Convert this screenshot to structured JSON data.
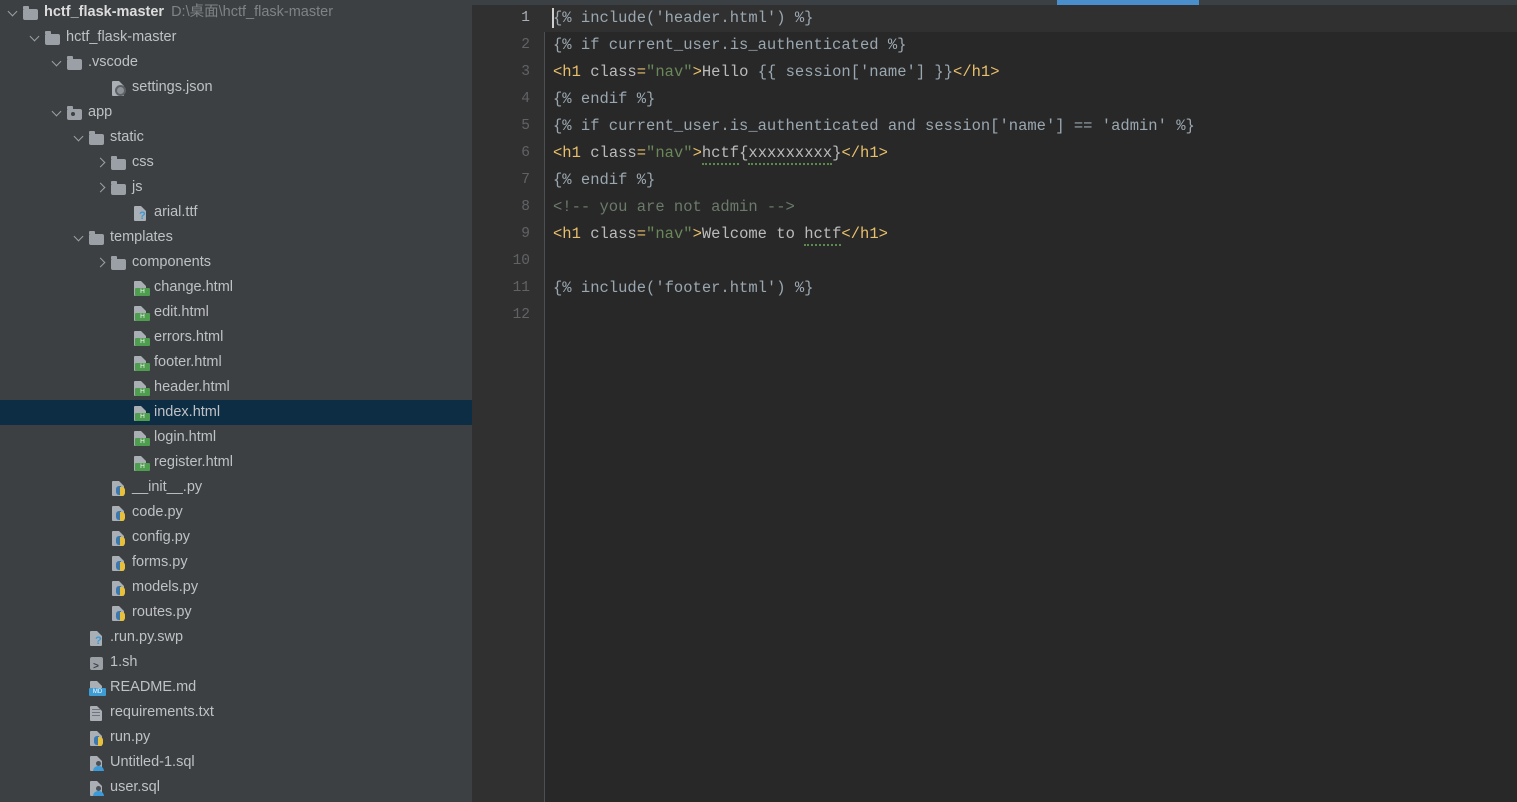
{
  "window": {
    "title": "hctf_flask-master",
    "theme_background": "#282828",
    "sidebar_background": "#3c4043",
    "selection_color": "#0d2d44",
    "accent_color": "#4a8fcc"
  },
  "sidebar": {
    "name": "project-tree",
    "rows": [
      {
        "label": "hctf_flask-master",
        "path_hint": "D:\\桌面\\hctf_flask-master",
        "depth": 0,
        "arrow": "down",
        "icon": "folder-icon",
        "bold": true,
        "selected": false
      },
      {
        "label": "hctf_flask-master",
        "path_hint": "",
        "depth": 1,
        "arrow": "down",
        "icon": "folder-icon",
        "bold": false,
        "selected": false
      },
      {
        "label": ".vscode",
        "path_hint": "",
        "depth": 2,
        "arrow": "down",
        "icon": "folder-icon",
        "bold": false,
        "selected": false
      },
      {
        "label": "settings.json",
        "path_hint": "",
        "depth": 4,
        "arrow": "none",
        "icon": "json-settings-file-icon",
        "bold": false,
        "selected": false
      },
      {
        "label": "app",
        "path_hint": "",
        "depth": 2,
        "arrow": "down",
        "icon": "source-folder-icon",
        "bold": false,
        "selected": false
      },
      {
        "label": "static",
        "path_hint": "",
        "depth": 3,
        "arrow": "down",
        "icon": "folder-icon",
        "bold": false,
        "selected": false
      },
      {
        "label": "css",
        "path_hint": "",
        "depth": 4,
        "arrow": "right",
        "icon": "folder-icon",
        "bold": false,
        "selected": false
      },
      {
        "label": "js",
        "path_hint": "",
        "depth": 4,
        "arrow": "right",
        "icon": "folder-icon",
        "bold": false,
        "selected": false
      },
      {
        "label": "arial.ttf",
        "path_hint": "",
        "depth": 5,
        "arrow": "none",
        "icon": "unknown-file-icon",
        "bold": false,
        "selected": false
      },
      {
        "label": "templates",
        "path_hint": "",
        "depth": 3,
        "arrow": "down",
        "icon": "folder-icon",
        "bold": false,
        "selected": false
      },
      {
        "label": "components",
        "path_hint": "",
        "depth": 4,
        "arrow": "right",
        "icon": "folder-icon",
        "bold": false,
        "selected": false
      },
      {
        "label": "change.html",
        "path_hint": "",
        "depth": 5,
        "arrow": "none",
        "icon": "html-file-icon",
        "bold": false,
        "selected": false
      },
      {
        "label": "edit.html",
        "path_hint": "",
        "depth": 5,
        "arrow": "none",
        "icon": "html-file-icon",
        "bold": false,
        "selected": false
      },
      {
        "label": "errors.html",
        "path_hint": "",
        "depth": 5,
        "arrow": "none",
        "icon": "html-file-icon",
        "bold": false,
        "selected": false
      },
      {
        "label": "footer.html",
        "path_hint": "",
        "depth": 5,
        "arrow": "none",
        "icon": "html-file-icon",
        "bold": false,
        "selected": false
      },
      {
        "label": "header.html",
        "path_hint": "",
        "depth": 5,
        "arrow": "none",
        "icon": "html-file-icon",
        "bold": false,
        "selected": false
      },
      {
        "label": "index.html",
        "path_hint": "",
        "depth": 5,
        "arrow": "none",
        "icon": "html-file-icon",
        "bold": false,
        "selected": true
      },
      {
        "label": "login.html",
        "path_hint": "",
        "depth": 5,
        "arrow": "none",
        "icon": "html-file-icon",
        "bold": false,
        "selected": false
      },
      {
        "label": "register.html",
        "path_hint": "",
        "depth": 5,
        "arrow": "none",
        "icon": "html-file-icon",
        "bold": false,
        "selected": false
      },
      {
        "label": "__init__.py",
        "path_hint": "",
        "depth": 4,
        "arrow": "none",
        "icon": "python-file-icon",
        "bold": false,
        "selected": false
      },
      {
        "label": "code.py",
        "path_hint": "",
        "depth": 4,
        "arrow": "none",
        "icon": "python-file-icon",
        "bold": false,
        "selected": false
      },
      {
        "label": "config.py",
        "path_hint": "",
        "depth": 4,
        "arrow": "none",
        "icon": "python-file-icon",
        "bold": false,
        "selected": false
      },
      {
        "label": "forms.py",
        "path_hint": "",
        "depth": 4,
        "arrow": "none",
        "icon": "python-file-icon",
        "bold": false,
        "selected": false
      },
      {
        "label": "models.py",
        "path_hint": "",
        "depth": 4,
        "arrow": "none",
        "icon": "python-file-icon",
        "bold": false,
        "selected": false
      },
      {
        "label": "routes.py",
        "path_hint": "",
        "depth": 4,
        "arrow": "none",
        "icon": "python-file-icon",
        "bold": false,
        "selected": false
      },
      {
        "label": ".run.py.swp",
        "path_hint": "",
        "depth": 3,
        "arrow": "none",
        "icon": "unknown-file-icon",
        "bold": false,
        "selected": false
      },
      {
        "label": "1.sh",
        "path_hint": "",
        "depth": 3,
        "arrow": "none",
        "icon": "shell-script-icon",
        "bold": false,
        "selected": false
      },
      {
        "label": "README.md",
        "path_hint": "",
        "depth": 3,
        "arrow": "none",
        "icon": "markdown-file-icon",
        "bold": false,
        "selected": false
      },
      {
        "label": "requirements.txt",
        "path_hint": "",
        "depth": 3,
        "arrow": "none",
        "icon": "text-file-icon",
        "bold": false,
        "selected": false
      },
      {
        "label": "run.py",
        "path_hint": "",
        "depth": 3,
        "arrow": "none",
        "icon": "python-file-icon",
        "bold": false,
        "selected": false
      },
      {
        "label": "Untitled-1.sql",
        "path_hint": "",
        "depth": 3,
        "arrow": "none",
        "icon": "sql-file-icon",
        "bold": false,
        "selected": false
      },
      {
        "label": "user.sql",
        "path_hint": "",
        "depth": 3,
        "arrow": "none",
        "icon": "sql-file-icon",
        "bold": false,
        "selected": false
      }
    ]
  },
  "editor": {
    "name": "code-editor",
    "active_line": 1,
    "line_numbers": [
      "1",
      "2",
      "3",
      "4",
      "5",
      "6",
      "7",
      "8",
      "9",
      "10",
      "11",
      "12"
    ],
    "lines": [
      {
        "n": 1,
        "tokens": [
          {
            "t": "{% include('header.html') %}",
            "c": "tk-tpl"
          }
        ]
      },
      {
        "n": 2,
        "tokens": [
          {
            "t": "{% if current_user.is_authenticated %}",
            "c": "tk-tpl"
          }
        ]
      },
      {
        "n": 3,
        "tokens": [
          {
            "t": "<h1 ",
            "c": "tk-tag"
          },
          {
            "t": "class",
            "c": "tk-attr"
          },
          {
            "t": "=",
            "c": "tk-tag"
          },
          {
            "t": "\"nav\"",
            "c": "tk-str"
          },
          {
            "t": ">",
            "c": "tk-tag"
          },
          {
            "t": "Hello ",
            "c": "tk-text"
          },
          {
            "t": "{{ session['name'] }}",
            "c": "tk-var"
          },
          {
            "t": "</h1>",
            "c": "tk-tag"
          }
        ]
      },
      {
        "n": 4,
        "tokens": [
          {
            "t": "{% endif %}",
            "c": "tk-tpl"
          }
        ]
      },
      {
        "n": 5,
        "tokens": [
          {
            "t": "{% if current_user.is_authenticated and session['name'] == 'admin' %}",
            "c": "tk-tpl"
          }
        ]
      },
      {
        "n": 6,
        "tokens": [
          {
            "t": "<h1 ",
            "c": "tk-tag"
          },
          {
            "t": "class",
            "c": "tk-attr"
          },
          {
            "t": "=",
            "c": "tk-tag"
          },
          {
            "t": "\"nav\"",
            "c": "tk-str"
          },
          {
            "t": ">",
            "c": "tk-tag"
          },
          {
            "t": "hctf",
            "c": "tk-text squig"
          },
          {
            "t": "{",
            "c": "tk-text"
          },
          {
            "t": "xxxxxxxxx",
            "c": "tk-text squig"
          },
          {
            "t": "}",
            "c": "tk-text"
          },
          {
            "t": "</h1>",
            "c": "tk-tag"
          }
        ]
      },
      {
        "n": 7,
        "tokens": [
          {
            "t": "{% endif %}",
            "c": "tk-tpl"
          }
        ]
      },
      {
        "n": 8,
        "tokens": [
          {
            "t": "<!-- you are not admin -->",
            "c": "tk-comment"
          }
        ]
      },
      {
        "n": 9,
        "tokens": [
          {
            "t": "<h1 ",
            "c": "tk-tag"
          },
          {
            "t": "class",
            "c": "tk-attr"
          },
          {
            "t": "=",
            "c": "tk-tag"
          },
          {
            "t": "\"nav\"",
            "c": "tk-str"
          },
          {
            "t": ">",
            "c": "tk-tag"
          },
          {
            "t": "Welcome to ",
            "c": "tk-text"
          },
          {
            "t": "hctf",
            "c": "tk-text squig"
          },
          {
            "t": "</h1>",
            "c": "tk-tag"
          }
        ]
      },
      {
        "n": 10,
        "tokens": []
      },
      {
        "n": 11,
        "tokens": [
          {
            "t": "{% include('footer.html') %}",
            "c": "tk-tpl"
          }
        ]
      },
      {
        "n": 12,
        "tokens": []
      }
    ]
  }
}
